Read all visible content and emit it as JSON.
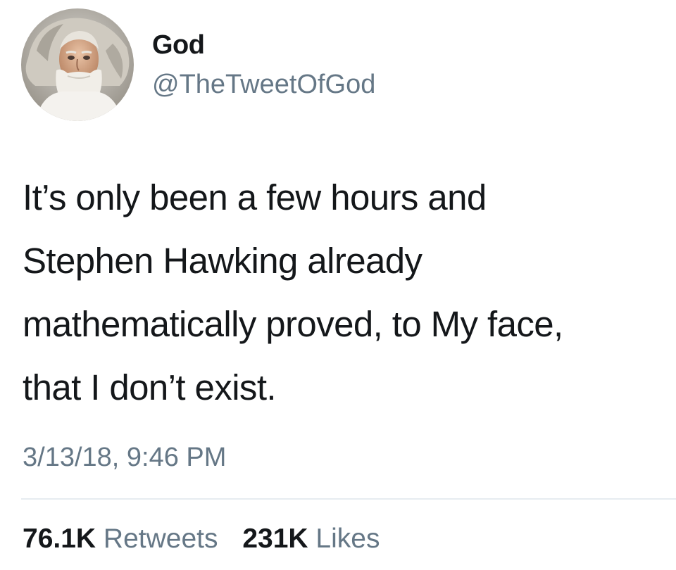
{
  "user": {
    "display_name": "God",
    "handle": "@TheTweetOfGod",
    "avatar_icon": "bearded-man-portrait"
  },
  "tweet": {
    "text_lines": [
      "It’s only been a few hours and",
      "Stephen Hawking already",
      "mathematically proved, to My face,",
      "that I don’t exist."
    ],
    "timestamp": "3/13/18, 9:46 PM"
  },
  "stats": {
    "retweets_count": "76.1K",
    "retweets_label": "Retweets",
    "likes_count": "231K",
    "likes_label": "Likes"
  },
  "colors": {
    "text_primary": "#14171a",
    "text_secondary": "#657786",
    "divider": "#e6ecf0"
  }
}
